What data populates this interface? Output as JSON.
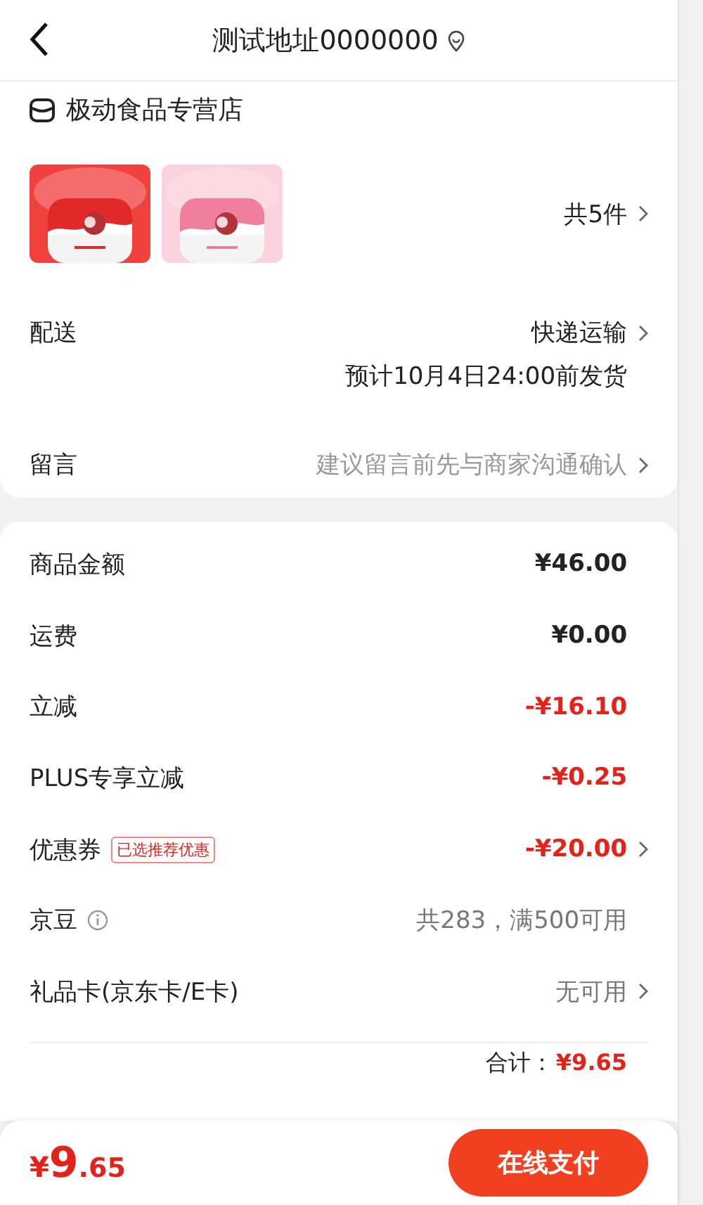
{
  "header": {
    "title": "测试地址0000000"
  },
  "shop": {
    "name": "极动食品专营店",
    "count": "共5件"
  },
  "delivery": {
    "label": "配送",
    "value": "快递运输",
    "note": "预计10月4日24:00前发货"
  },
  "message": {
    "label": "留言",
    "placeholder": "建议留言前先与商家沟通确认"
  },
  "summary": [
    {
      "label": "商品金额",
      "value": "¥46.00",
      "kind": "amount",
      "link": false
    },
    {
      "label": "运费",
      "value": "¥0.00",
      "kind": "amount",
      "link": false
    },
    {
      "label": "立减",
      "value": "-¥16.10",
      "kind": "discount",
      "link": false
    },
    {
      "label": "PLUS专享立减",
      "value": "-¥0.25",
      "kind": "discount",
      "link": false
    },
    {
      "label": "优惠券",
      "tag": "已选推荐优惠",
      "value": "-¥20.00",
      "kind": "discount",
      "link": true
    },
    {
      "label": "京豆",
      "info": true,
      "value": "共283，满500可用",
      "kind": "muted",
      "link": false
    },
    {
      "label": "礼品卡(京东卡/E卡)",
      "value": "无可用",
      "kind": "muted",
      "link": true
    }
  ],
  "total": {
    "label": "合计：",
    "value": "¥9.65"
  },
  "pay": {
    "symbol": "¥",
    "integer": "9",
    "decimal": ".65",
    "button": "在线支付"
  }
}
